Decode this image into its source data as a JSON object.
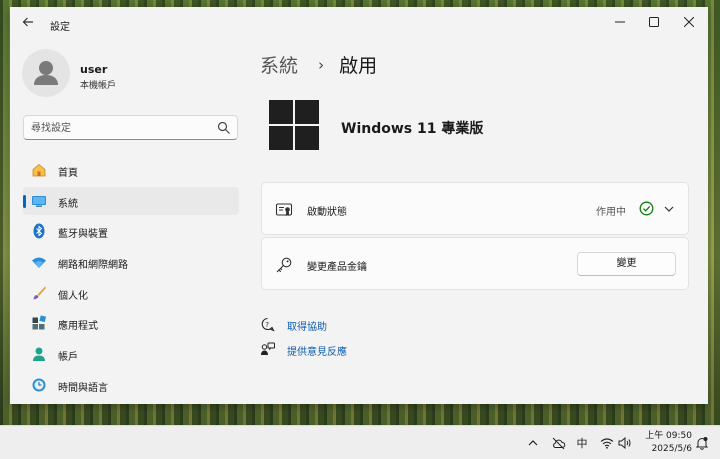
{
  "window": {
    "app_title": "設定",
    "back_icon": "back-arrow-icon",
    "controls": [
      "minimize-icon",
      "maximize-icon",
      "close-icon"
    ]
  },
  "profile": {
    "name": "user",
    "account_type": "本機帳戶"
  },
  "search": {
    "placeholder": "尋找設定"
  },
  "sidebar": {
    "items": [
      {
        "label": "首頁",
        "icon": "home-icon",
        "active": false
      },
      {
        "label": "系統",
        "icon": "system-icon",
        "active": true
      },
      {
        "label": "藍牙與裝置",
        "icon": "bluetooth-icon",
        "active": false
      },
      {
        "label": "網路和網際網路",
        "icon": "network-icon",
        "active": false
      },
      {
        "label": "個人化",
        "icon": "brush-icon",
        "active": false
      },
      {
        "label": "應用程式",
        "icon": "apps-icon",
        "active": false
      },
      {
        "label": "帳戶",
        "icon": "account-icon",
        "active": false
      },
      {
        "label": "時間與語言",
        "icon": "time-language-icon",
        "active": false
      }
    ]
  },
  "breadcrumb": {
    "parent": "系統",
    "separator": "›",
    "current": "啟用"
  },
  "product": {
    "name": "Windows 11 專業版",
    "logo_color": "#1f1f1f"
  },
  "activation_card": {
    "label": "啟動狀態",
    "status": "作用中",
    "status_color": "#0f7b0f"
  },
  "change_key_card": {
    "label": "變更產品金鑰",
    "button_label": "變更"
  },
  "links": {
    "help": "取得協助",
    "feedback": "提供意見反應"
  },
  "taskbar": {
    "ime": "中",
    "time": "上午 09:50",
    "date": "2025/5/6"
  },
  "colors": {
    "accent": "#0067c0",
    "link": "#0b5cad"
  }
}
